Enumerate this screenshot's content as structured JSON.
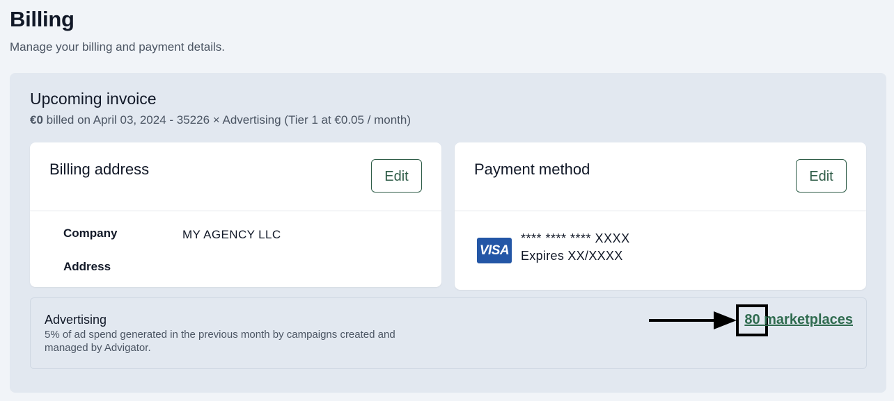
{
  "header": {
    "title": "Billing",
    "subtitle": "Manage your billing and payment details."
  },
  "invoice": {
    "title": "Upcoming invoice",
    "amount": "€0",
    "detail": " billed on April 03, 2024 - 35226 × Advertising (Tier 1 at €0.05 / month)"
  },
  "billing_address": {
    "title": "Billing address",
    "edit_label": "Edit",
    "company_label": "Company",
    "company_value": "MY AGENCY LLC",
    "address_label": "Address",
    "address_value": ""
  },
  "payment_method": {
    "title": "Payment method",
    "edit_label": "Edit",
    "card_brand": "VISA",
    "card_number": "**** **** **** XXXX",
    "expiry": "Expires XX/XXXX"
  },
  "advertising": {
    "title": "Advertising",
    "description": "5% of ad spend generated in the previous month by campaigns created and managed by Advigator.",
    "marketplaces_link": "80 marketplaces"
  },
  "colors": {
    "accent": "#2f5d48",
    "link": "#2f6b4f",
    "visa": "#2356a6",
    "panel_bg": "#e2e8f0"
  },
  "icons": {
    "card_brand_icon": "visa-logo-icon",
    "annotation_arrow": "right-arrow-icon"
  }
}
